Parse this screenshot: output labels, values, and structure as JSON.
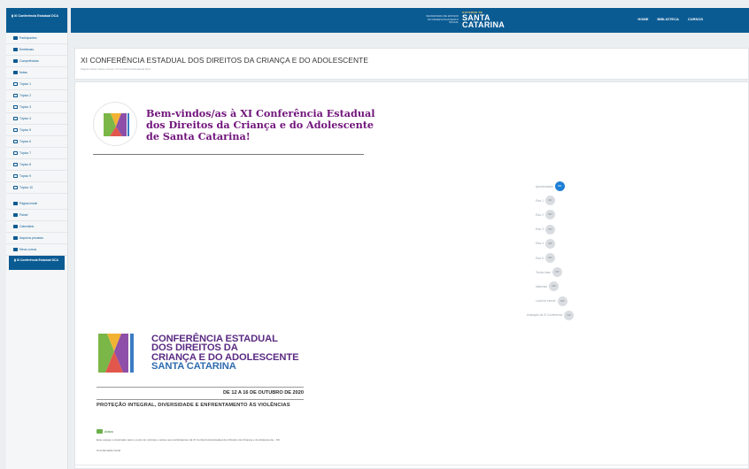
{
  "sidebar": {
    "header": "XI Conferência Estadual DCA",
    "items": [
      {
        "label": "Participantes",
        "icon": "users-icon"
      },
      {
        "label": "Emblemas",
        "icon": "badge-icon"
      },
      {
        "label": "Competências",
        "icon": "check-icon"
      },
      {
        "label": "Notas",
        "icon": "grid-icon"
      },
      {
        "label": "Tópico 1",
        "icon": "folder-icon"
      },
      {
        "label": "Tópico 2",
        "icon": "folder-icon"
      },
      {
        "label": "Tópico 3",
        "icon": "folder-icon"
      },
      {
        "label": "Tópico 4",
        "icon": "folder-icon"
      },
      {
        "label": "Tópico 5",
        "icon": "folder-icon"
      },
      {
        "label": "Tópico 6",
        "icon": "folder-icon"
      },
      {
        "label": "Tópico 7",
        "icon": "folder-icon"
      },
      {
        "label": "Tópico 8",
        "icon": "folder-icon"
      },
      {
        "label": "Tópico 9",
        "icon": "folder-icon"
      },
      {
        "label": "Tópico 10",
        "icon": "folder-icon"
      }
    ],
    "secondary": [
      {
        "label": "Página inicial",
        "icon": "home-icon"
      },
      {
        "label": "Painel",
        "icon": "dashboard-icon"
      },
      {
        "label": "Calendário",
        "icon": "calendar-icon"
      },
      {
        "label": "Arquivos privados",
        "icon": "file-icon"
      },
      {
        "label": "Meus cursos",
        "icon": "graduation-icon"
      }
    ],
    "active_course": "XI Conferência Estadual DCA"
  },
  "navbar": {
    "logo_small": "SECRETARIA DE ESTADO DO DESENVOLVIMENTO SOCIAL",
    "logo_top": "GOVERNO DE",
    "logo_main_1": "SANTA",
    "logo_main_2": "CATARINA",
    "links": [
      "HOME",
      "BIBLIOTECA",
      "CURSOS"
    ]
  },
  "header": {
    "title": "XI CONFERÊNCIA ESTADUAL DOS DIREITOS DA CRIANÇA E DO ADOLESCENTE",
    "breadcrumb": "Página inicial / Meus cursos / XI Conferência Estadual DCA"
  },
  "banner": {
    "line1": "Bem-vindos/as à XI Conferência Estadual",
    "line2": "dos Direitos da Criança e do Adolescente",
    "line3": "de Santa Catarina!"
  },
  "timeline": [
    {
      "label": "Apresentação",
      "badge": "001",
      "active": true
    },
    {
      "label": "Eixo 1",
      "badge": "002",
      "active": false
    },
    {
      "label": "Eixo 2",
      "badge": "003",
      "active": false
    },
    {
      "label": "Eixo 3",
      "badge": "004",
      "active": false
    },
    {
      "label": "Eixo 4",
      "badge": "005",
      "active": false
    },
    {
      "label": "Eixo 5",
      "badge": "006",
      "active": false
    },
    {
      "label": "Textos base",
      "badge": "007",
      "active": false
    },
    {
      "label": "Materiais",
      "badge": "008",
      "active": false
    },
    {
      "label": "Local do evento",
      "badge": "009",
      "active": false
    },
    {
      "label": "Avaliação da XI Conferência",
      "badge": "010",
      "active": false
    }
  ],
  "poster": {
    "title_l1": "CONFERÊNCIA ESTADUAL",
    "title_l2": "DOS DIREITOS DA",
    "title_l3": "CRIANÇA E DO ADOLESCENTE",
    "title_l4": "SANTA CATARINA",
    "dates": "DE 12 A 16 DE OUTUBRO DE 2020",
    "motto": "PROTEÇÃO INTEGRAL, DIVERSIDADE E ENFRENTAMENTO ÀS VIOLÊNCIAS"
  },
  "section": {
    "link_label": "Avisos",
    "paragraph": "Este espaço é destinado para o envio de notícias e avisos aos participantes da XI Conferência Estadual dos Direitos da Criança e do Adolescente - SC.",
    "signature": "Coordenação Geral"
  },
  "colors": {
    "brand": "#0b5b93",
    "purple": "#70137b",
    "accent": "#1f7fd6"
  }
}
